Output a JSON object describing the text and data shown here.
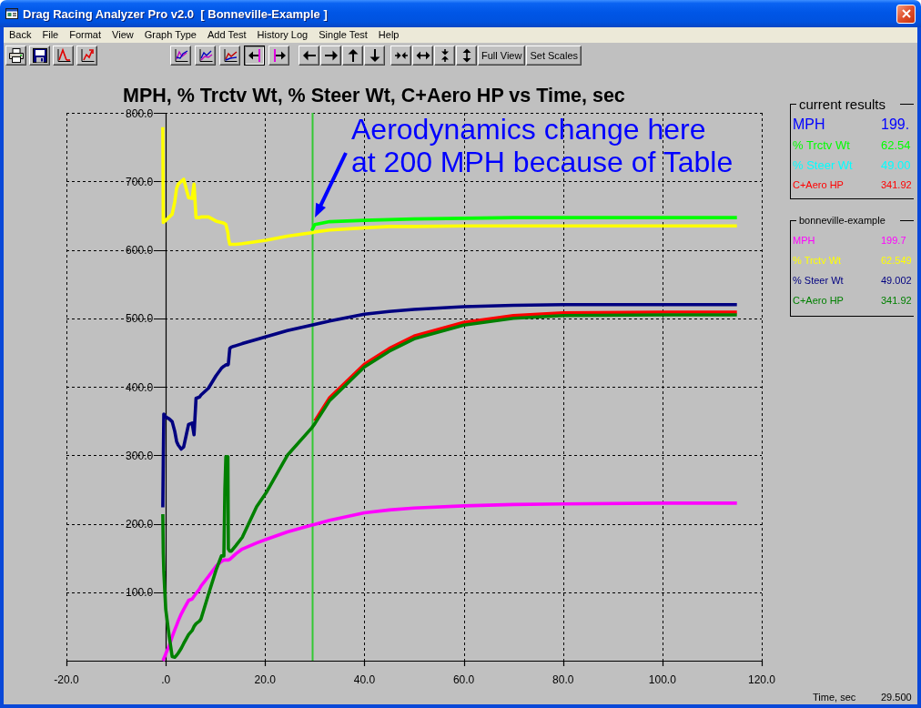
{
  "window": {
    "title": "Drag Racing Analyzer Pro v2.0  [ Bonneville-Example ]"
  },
  "menu": [
    "Back",
    "File",
    "Format",
    "View",
    "Graph Type",
    "Add Test",
    "History Log",
    "Single Test",
    "Help"
  ],
  "toolbar": {
    "groups": [
      {
        "buttons": [
          {
            "kind": "icon",
            "pressed": false
          },
          {
            "kind": "icon",
            "pressed": false
          },
          {
            "kind": "icon",
            "pressed": false
          },
          {
            "kind": "icon",
            "pressed": false
          }
        ]
      },
      {
        "buttons": [
          {
            "kind": "icon",
            "pressed": false
          },
          {
            "kind": "icon",
            "pressed": false
          },
          {
            "kind": "icon",
            "pressed": false
          },
          {
            "kind": "icon",
            "pressed": true
          },
          {
            "kind": "icon",
            "pressed": false
          }
        ]
      },
      {
        "buttons": [
          {
            "kind": "icon",
            "pressed": false
          },
          {
            "kind": "icon",
            "pressed": false
          },
          {
            "kind": "icon",
            "pressed": false
          },
          {
            "kind": "icon",
            "pressed": false
          }
        ]
      },
      {
        "buttons": [
          {
            "kind": "icon",
            "pressed": false
          },
          {
            "kind": "icon",
            "pressed": false
          },
          {
            "kind": "icon",
            "pressed": false
          },
          {
            "kind": "icon",
            "pressed": false
          },
          {
            "kind": "text",
            "label": "Full View",
            "pressed": false
          },
          {
            "kind": "text",
            "label": "Set Scales",
            "pressed": false
          }
        ]
      }
    ]
  },
  "chart": {
    "chart_data": {
      "type": "line",
      "title": "MPH, % Trctv Wt, % Steer Wt, C+Aero HP vs Time, sec",
      "x": [
        -0.6,
        -0.5,
        -0.4,
        -0.1,
        0,
        0.7,
        1.3,
        1.8,
        2.2,
        2.5,
        3.1,
        3.6,
        4.6,
        5.3,
        5.7,
        6.1,
        6.8,
        7.1,
        8.6,
        10.1,
        11.2,
        11.7,
        11.9,
        12.1,
        12.5,
        12.6,
        12.9,
        13.2,
        14.1,
        15.4,
        18.3,
        20.2,
        24.5,
        29.4,
        30,
        33,
        40,
        45,
        50,
        60,
        70,
        80,
        100,
        115
      ],
      "series": [
        {
          "name": "MPH",
          "color": "#0000ff",
          "values": [
            null,
            null,
            null,
            null,
            null,
            null,
            null,
            null,
            null,
            null,
            null,
            null,
            null,
            null,
            null,
            null,
            null,
            null,
            null,
            null,
            null,
            null,
            null,
            null,
            null,
            null,
            null,
            null,
            null,
            null,
            null,
            null,
            null,
            null,
            null,
            null,
            null,
            null,
            null,
            null,
            null,
            null,
            null,
            null
          ]
        },
        {
          "name": "% Trctv Wt",
          "color": "#00ff00",
          "values": [
            null,
            null,
            null,
            null,
            null,
            null,
            null,
            null,
            null,
            null,
            null,
            null,
            null,
            null,
            null,
            null,
            null,
            null,
            null,
            null,
            null,
            null,
            null,
            null,
            null,
            null,
            null,
            null,
            null,
            null,
            null,
            null,
            null,
            628,
            637,
            641,
            643,
            644,
            645,
            646,
            647,
            647,
            647,
            647
          ]
        },
        {
          "name": "% Steer Wt",
          "color": "#00ffff",
          "values": [
            null,
            null,
            null,
            null,
            null,
            null,
            null,
            null,
            null,
            null,
            null,
            null,
            null,
            null,
            null,
            null,
            null,
            null,
            null,
            null,
            null,
            null,
            null,
            null,
            null,
            null,
            null,
            null,
            null,
            null,
            null,
            null,
            null,
            null,
            null,
            null,
            null,
            null,
            null,
            null,
            null,
            null,
            null,
            null
          ]
        },
        {
          "name": "C+Aero HP",
          "color": "#ff0000",
          "values": [
            null,
            null,
            null,
            null,
            null,
            null,
            null,
            null,
            null,
            null,
            null,
            null,
            null,
            null,
            null,
            null,
            null,
            null,
            null,
            null,
            null,
            null,
            null,
            null,
            null,
            null,
            null,
            null,
            null,
            null,
            null,
            null,
            null,
            null,
            350,
            384,
            433,
            456,
            474,
            494,
            504,
            508,
            509,
            509
          ]
        },
        {
          "name": "MPH",
          "color": "#ff00ff",
          "values": [
            0,
            1,
            3,
            8,
            10,
            22,
            35,
            45,
            52,
            58,
            68,
            75,
            88,
            90,
            94,
            98,
            105,
            109,
            123,
            138,
            145,
            147,
            147,
            147,
            147,
            147,
            148,
            150,
            156,
            163,
            172,
            177,
            188,
            198,
            199,
            205,
            216,
            220,
            223,
            226,
            228,
            229,
            230,
            230
          ]
        },
        {
          "name": "% Trctv Wt",
          "color": "#ffff00",
          "values": [
            779,
            640,
            641,
            642,
            643,
            648,
            652,
            670,
            690,
            696,
            700,
            703,
            676,
            675,
            696,
            647,
            647,
            648,
            648,
            642,
            640,
            639,
            638,
            637,
            625,
            618,
            608,
            608,
            608,
            609,
            612,
            614,
            620,
            625,
            626,
            629,
            632,
            634,
            634,
            635,
            635,
            635,
            635,
            635
          ]
        },
        {
          "name": "% Steer Wt",
          "color": "#000080",
          "values": [
            224,
            291,
            360,
            357,
            356,
            353,
            349,
            335,
            320,
            315,
            309,
            312,
            345,
            347,
            330,
            383,
            385,
            388,
            398,
            416,
            427,
            430,
            431,
            432,
            432,
            433,
            456,
            458,
            460,
            463,
            469,
            473,
            482,
            490,
            491,
            496,
            506,
            510,
            513,
            517,
            519,
            520,
            520,
            520
          ]
        },
        {
          "name": "C+Aero HP",
          "color": "#008000",
          "values": [
            214,
            158,
            130,
            88,
            75,
            35,
            6,
            5,
            8,
            11,
            18,
            25,
            38,
            44,
            50,
            54,
            58,
            61,
            97,
            132,
            153,
            153,
            250,
            298,
            298,
            163,
            160,
            160,
            168,
            180,
            225,
            245,
            300,
            340,
            346,
            380,
            429,
            452,
            470,
            490,
            500,
            504,
            505,
            505
          ]
        }
      ],
      "xlim": [
        -20,
        120
      ],
      "ylim": [
        0,
        800
      ],
      "xticks": [
        {
          "value": -20,
          "label": "-20.0"
        },
        {
          "value": 0,
          "label": ".0"
        },
        {
          "value": 20,
          "label": "20.0"
        },
        {
          "value": 40,
          "label": "40.0"
        },
        {
          "value": 60,
          "label": "60.0"
        },
        {
          "value": 80,
          "label": "80.0"
        },
        {
          "value": 100,
          "label": "100.0"
        },
        {
          "value": 120,
          "label": "120.0"
        }
      ],
      "yticks": [
        {
          "value": 100,
          "label": "100.0"
        },
        {
          "value": 200,
          "label": "200.0"
        },
        {
          "value": 300,
          "label": "300.0"
        },
        {
          "value": 400,
          "label": "400.0"
        },
        {
          "value": 500,
          "label": "500.0"
        },
        {
          "value": 600,
          "label": "600.0"
        },
        {
          "value": 700,
          "label": "700.0"
        },
        {
          "value": 800,
          "label": "800.0"
        }
      ],
      "grid": true,
      "ref_lines": [
        {
          "axis": "x",
          "value": 29.5
        }
      ],
      "annotations": [
        {
          "text": "Aerodynamics change here\nat 200 MPH because of Table",
          "x": 29.5,
          "y": 626
        }
      ]
    },
    "cursor": {
      "label": "Time, sec",
      "value": "29.500"
    }
  },
  "legends": [
    {
      "title": "current results",
      "values": [
        "199.",
        "62.54",
        "49.00",
        "341.92"
      ]
    },
    {
      "title": "bonneville-example",
      "values": [
        "199.7",
        "62.549",
        "49.002",
        "341.92"
      ]
    }
  ]
}
